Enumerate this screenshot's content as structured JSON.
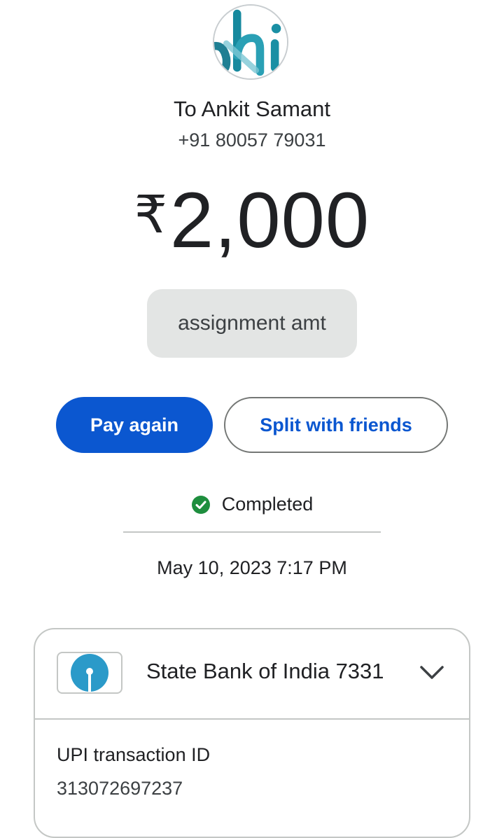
{
  "header": {
    "avatar_icon": "hi-logo-avatar",
    "recipient": "To Ankit Samant",
    "phone": "+91 80057 79031"
  },
  "payment": {
    "currency_symbol": "₹",
    "amount": "2,000",
    "note": "assignment amt"
  },
  "actions": {
    "pay_again": "Pay again",
    "split": "Split with friends"
  },
  "status": {
    "icon": "check-circle-icon",
    "label": "Completed",
    "color": "#1e8e3e",
    "datetime": "May 10, 2023 7:17 PM"
  },
  "details": {
    "bank_icon": "sbi-logo",
    "bank_name": "State Bank of India 7331",
    "expand_icon": "chevron-down-icon",
    "upi_label": "UPI transaction ID",
    "upi_id": "313072697237"
  },
  "colors": {
    "primary": "#0b57d0",
    "note_bg": "#e3e5e4",
    "sbi_blue": "#2b9ac9",
    "avatar_teal": "#2a93a6"
  }
}
